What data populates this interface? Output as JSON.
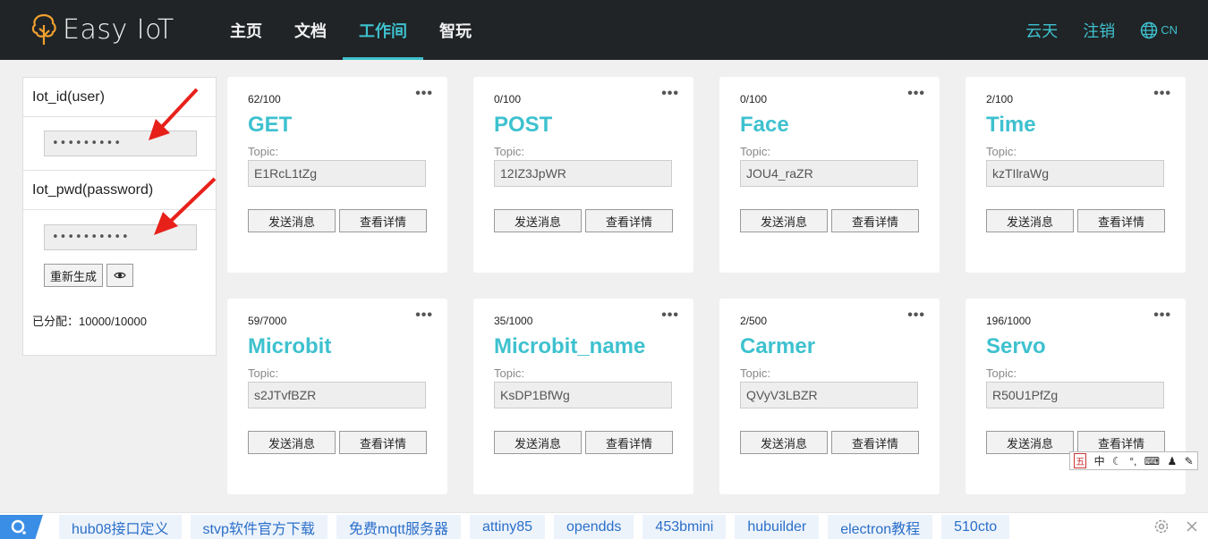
{
  "header": {
    "logo_text": "Easy IoT",
    "nav": [
      {
        "label": "主页"
      },
      {
        "label": "文档"
      },
      {
        "label": "工作间"
      },
      {
        "label": "智玩"
      }
    ],
    "active_nav": "工作间",
    "user_link": "云天",
    "logout_link": "注销",
    "lang_label": "CN"
  },
  "sidebar": {
    "user_label": "Iot_id(user)",
    "user_value": "•••••••••",
    "pwd_label": "Iot_pwd(password)",
    "pwd_value": "••••••••••",
    "regenerate_label": "重新生成",
    "allocated_label": "已分配：",
    "allocated_value": "10000/10000"
  },
  "topic_label": "Topic:",
  "cards": [
    {
      "count": "62/100",
      "name": "GET",
      "topic": "E1RcL1tZg",
      "send": "发送消息",
      "detail": "查看详情"
    },
    {
      "count": "0/100",
      "name": "POST",
      "topic": "12IZ3JpWR",
      "send": "发送消息",
      "detail": "查看详情"
    },
    {
      "count": "0/100",
      "name": "Face",
      "topic": "JOU4_raZR",
      "send": "发送消息",
      "detail": "查看详情"
    },
    {
      "count": "2/100",
      "name": "Time",
      "topic": "kzTIlraWg",
      "send": "发送消息",
      "detail": "查看详情"
    },
    {
      "count": "59/7000",
      "name": "Microbit",
      "topic": "s2JTvfBZR",
      "send": "发送消息",
      "detail": "查看详情"
    },
    {
      "count": "35/1000",
      "name": "Microbit_name",
      "topic": "KsDP1BfWg",
      "send": "发送消息",
      "detail": "查看详情"
    },
    {
      "count": "2/500",
      "name": "Carmer",
      "topic": "QVyV3LBZR",
      "send": "发送消息",
      "detail": "查看详情"
    },
    {
      "count": "196/1000",
      "name": "Servo",
      "topic": "R50U1PfZg",
      "send": "发送消息",
      "detail": "查看详情"
    }
  ],
  "ime": {
    "label_wu": "五",
    "label_zh": "中"
  },
  "bottom_tags": [
    "hub08接口定义",
    "stvp软件官方下载",
    "免费mqtt服务器",
    "attiny85",
    "opendds",
    "453bmini",
    "hubuilder",
    "electron教程",
    "510cto"
  ],
  "colors": {
    "accent": "#3ec1cf",
    "header_bg": "#202426",
    "annotation_arrow": "#e8201a"
  }
}
